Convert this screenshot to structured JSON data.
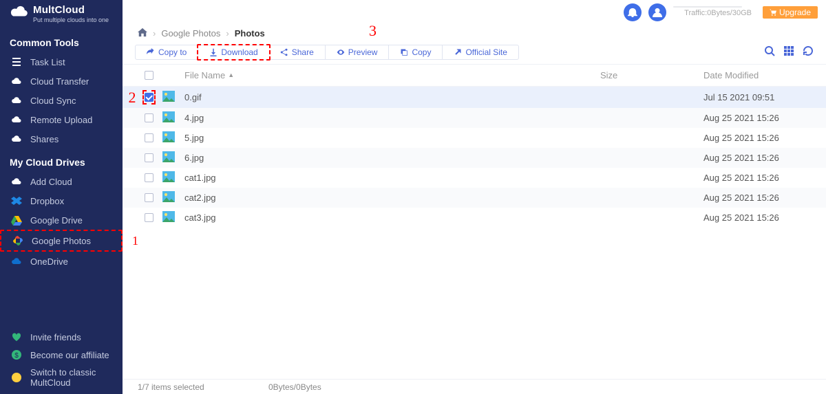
{
  "app": {
    "title": "MultCloud",
    "subtitle": "Put multiple clouds into one"
  },
  "sidebar": {
    "common_title": "Common Tools",
    "common_items": [
      {
        "label": "Task List",
        "icon": "list-icon"
      },
      {
        "label": "Cloud Transfer",
        "icon": "cloud-transfer-icon"
      },
      {
        "label": "Cloud Sync",
        "icon": "cloud-sync-icon"
      },
      {
        "label": "Remote Upload",
        "icon": "cloud-upload-icon"
      },
      {
        "label": "Shares",
        "icon": "cloud-share-icon"
      }
    ],
    "drives_title": "My Cloud Drives",
    "drive_items": [
      {
        "label": "Add Cloud",
        "icon": "cloud-add-icon"
      },
      {
        "label": "Dropbox",
        "icon": "dropbox-icon"
      },
      {
        "label": "Google Drive",
        "icon": "google-drive-icon"
      },
      {
        "label": "Google Photos",
        "icon": "google-photos-icon",
        "highlighted": true
      },
      {
        "label": "OneDrive",
        "icon": "onedrive-icon"
      }
    ],
    "bottom_items": [
      {
        "label": "Invite friends",
        "icon": "heart-icon"
      },
      {
        "label": "Become our affiliate",
        "icon": "dollar-icon"
      },
      {
        "label": "Switch to classic MultCloud",
        "icon": "smile-icon"
      }
    ]
  },
  "header": {
    "traffic": "Traffic:0Bytes/30GB",
    "upgrade": "Upgrade"
  },
  "breadcrumb": {
    "parts": [
      "Google Photos",
      "Photos"
    ]
  },
  "toolbar": {
    "copy_to": "Copy to",
    "download": "Download",
    "share": "Share",
    "preview": "Preview",
    "copy": "Copy",
    "official_site": "Official Site"
  },
  "table": {
    "headers": {
      "name": "File Name",
      "size": "Size",
      "date": "Date Modified"
    },
    "rows": [
      {
        "name": "0.gif",
        "size": "",
        "date": "Jul 15 2021 09:51",
        "selected": true
      },
      {
        "name": "4.jpg",
        "size": "",
        "date": "Aug 25 2021 15:26",
        "selected": false
      },
      {
        "name": "5.jpg",
        "size": "",
        "date": "Aug 25 2021 15:26",
        "selected": false
      },
      {
        "name": "6.jpg",
        "size": "",
        "date": "Aug 25 2021 15:26",
        "selected": false
      },
      {
        "name": "cat1.jpg",
        "size": "",
        "date": "Aug 25 2021 15:26",
        "selected": false
      },
      {
        "name": "cat2.jpg",
        "size": "",
        "date": "Aug 25 2021 15:26",
        "selected": false
      },
      {
        "name": "cat3.jpg",
        "size": "",
        "date": "Aug 25 2021 15:26",
        "selected": false
      }
    ]
  },
  "status": {
    "selection": "1/7 items selected",
    "bytes": "0Bytes/0Bytes"
  },
  "annotations": {
    "a1": "1",
    "a2": "2",
    "a3": "3"
  }
}
